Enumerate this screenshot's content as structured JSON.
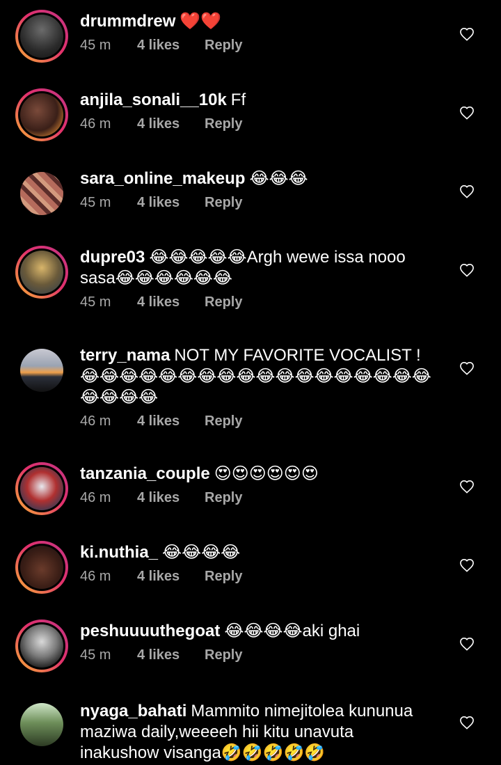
{
  "comments": [
    {
      "username": "drummdrew",
      "text": "❤️❤️",
      "time": "45 m",
      "likes": "4 likes",
      "reply": "Reply"
    },
    {
      "username": "anjila_sonali__10k",
      "text": "Ff",
      "time": "46 m",
      "likes": "4 likes",
      "reply": "Reply"
    },
    {
      "username": "sara_online_makeup",
      "text": "😂😂😂",
      "time": "45 m",
      "likes": "4 likes",
      "reply": "Reply"
    },
    {
      "username": "dupre03",
      "text": "😂😂😂😂😂Argh wewe issa nooo sasa😂😂😂😂😂😂",
      "time": "45 m",
      "likes": "4 likes",
      "reply": "Reply"
    },
    {
      "username": "terry_nama",
      "text": "NOT MY FAVORITE VOCALIST ! 😂😂😂😂😂😂😂😂😂😂😂😂😂😂😂😂😂😂😂😂😂😂",
      "time": "46 m",
      "likes": "4 likes",
      "reply": "Reply"
    },
    {
      "username": "tanzania_couple",
      "text": "😍😍😍😍😍😍",
      "time": "46 m",
      "likes": "4 likes",
      "reply": "Reply"
    },
    {
      "username": "ki.nuthia_",
      "text": "😂😂😂😂",
      "time": "46 m",
      "likes": "4 likes",
      "reply": "Reply"
    },
    {
      "username": "peshuuuuthegoat",
      "text": "😂😂😂😂aki ghai",
      "time": "45 m",
      "likes": "4 likes",
      "reply": "Reply"
    },
    {
      "username": "nyaga_bahati",
      "text": "Mammito nimejitolea kununua maziwa daily,weeeeh hii kitu unavuta inakushow visanga🤣🤣🤣🤣🤣",
      "time": "",
      "likes": "",
      "reply": ""
    }
  ],
  "icons": {
    "like": "heart-outline-icon"
  },
  "colors": {
    "background": "#000000",
    "meta": "#a8a8a8",
    "ring_start": "#f9b234",
    "ring_end": "#c13584"
  }
}
